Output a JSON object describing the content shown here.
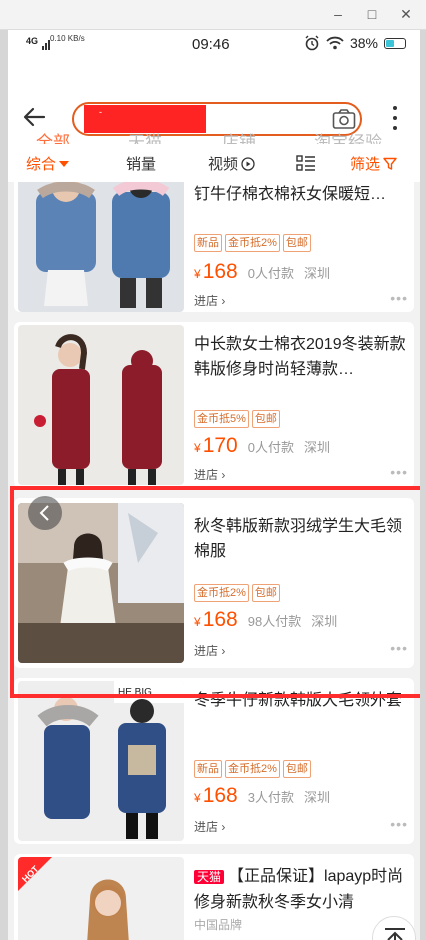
{
  "status": {
    "net": "4G",
    "speed": "0.10 KB/s",
    "time": "09:46",
    "battery": "38%"
  },
  "search": {
    "query": "-"
  },
  "scopes": [
    {
      "label": "全部"
    },
    {
      "label": "天猫"
    },
    {
      "label": "店铺"
    },
    {
      "label": "淘宝经验"
    }
  ],
  "filters": {
    "sort": "综合",
    "sales": "销量",
    "video": "视频",
    "filter": "筛选"
  },
  "products": [
    {
      "title": "钉牛仔棉衣棉袄女保暖短…",
      "tags": [
        "新品",
        "金币抵2%",
        "包邮"
      ],
      "price": "168",
      "sold": "0人付款",
      "location": "深圳",
      "store": "进店 ›"
    },
    {
      "title": "中长款女士棉衣2019冬装新款韩版修身时尚轻薄款…",
      "tags": [
        "金币抵5%",
        "包邮"
      ],
      "price": "170",
      "sold": "0人付款",
      "location": "深圳",
      "store": "进店 ›"
    },
    {
      "title": "秋冬韩版新款羽绒学生大毛领棉服",
      "tags": [
        "金币抵2%",
        "包邮"
      ],
      "price": "168",
      "sold": "98人付款",
      "location": "深圳",
      "store": "进店 ›"
    },
    {
      "title": "冬季牛仔新款韩版大毛领外套",
      "tags": [
        "新品",
        "金币抵2%",
        "包邮"
      ],
      "price": "168",
      "sold": "3人付款",
      "location": "深圳",
      "store": "进店 ›"
    },
    {
      "badge": "天猫",
      "title": "【正品保证】lapayp时尚修身新款秋冬季女小清",
      "brand": "中国品牌",
      "hot": "HOT"
    }
  ],
  "yen": "¥",
  "colors": {
    "accent": "#ff5000",
    "highlight": "#ff2d2d",
    "tmall": "#ff0036"
  }
}
